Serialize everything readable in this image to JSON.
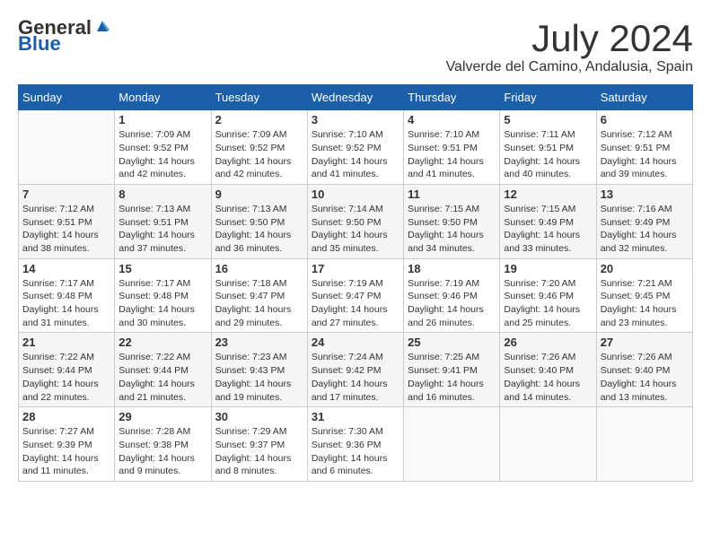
{
  "header": {
    "logo_general": "General",
    "logo_blue": "Blue",
    "month_year": "July 2024",
    "location": "Valverde del Camino, Andalusia, Spain"
  },
  "calendar": {
    "days_of_week": [
      "Sunday",
      "Monday",
      "Tuesday",
      "Wednesday",
      "Thursday",
      "Friday",
      "Saturday"
    ],
    "weeks": [
      [
        {
          "day": "",
          "info": ""
        },
        {
          "day": "1",
          "info": "Sunrise: 7:09 AM\nSunset: 9:52 PM\nDaylight: 14 hours\nand 42 minutes."
        },
        {
          "day": "2",
          "info": "Sunrise: 7:09 AM\nSunset: 9:52 PM\nDaylight: 14 hours\nand 42 minutes."
        },
        {
          "day": "3",
          "info": "Sunrise: 7:10 AM\nSunset: 9:52 PM\nDaylight: 14 hours\nand 41 minutes."
        },
        {
          "day": "4",
          "info": "Sunrise: 7:10 AM\nSunset: 9:51 PM\nDaylight: 14 hours\nand 41 minutes."
        },
        {
          "day": "5",
          "info": "Sunrise: 7:11 AM\nSunset: 9:51 PM\nDaylight: 14 hours\nand 40 minutes."
        },
        {
          "day": "6",
          "info": "Sunrise: 7:12 AM\nSunset: 9:51 PM\nDaylight: 14 hours\nand 39 minutes."
        }
      ],
      [
        {
          "day": "7",
          "info": "Sunrise: 7:12 AM\nSunset: 9:51 PM\nDaylight: 14 hours\nand 38 minutes."
        },
        {
          "day": "8",
          "info": "Sunrise: 7:13 AM\nSunset: 9:51 PM\nDaylight: 14 hours\nand 37 minutes."
        },
        {
          "day": "9",
          "info": "Sunrise: 7:13 AM\nSunset: 9:50 PM\nDaylight: 14 hours\nand 36 minutes."
        },
        {
          "day": "10",
          "info": "Sunrise: 7:14 AM\nSunset: 9:50 PM\nDaylight: 14 hours\nand 35 minutes."
        },
        {
          "day": "11",
          "info": "Sunrise: 7:15 AM\nSunset: 9:50 PM\nDaylight: 14 hours\nand 34 minutes."
        },
        {
          "day": "12",
          "info": "Sunrise: 7:15 AM\nSunset: 9:49 PM\nDaylight: 14 hours\nand 33 minutes."
        },
        {
          "day": "13",
          "info": "Sunrise: 7:16 AM\nSunset: 9:49 PM\nDaylight: 14 hours\nand 32 minutes."
        }
      ],
      [
        {
          "day": "14",
          "info": "Sunrise: 7:17 AM\nSunset: 9:48 PM\nDaylight: 14 hours\nand 31 minutes."
        },
        {
          "day": "15",
          "info": "Sunrise: 7:17 AM\nSunset: 9:48 PM\nDaylight: 14 hours\nand 30 minutes."
        },
        {
          "day": "16",
          "info": "Sunrise: 7:18 AM\nSunset: 9:47 PM\nDaylight: 14 hours\nand 29 minutes."
        },
        {
          "day": "17",
          "info": "Sunrise: 7:19 AM\nSunset: 9:47 PM\nDaylight: 14 hours\nand 27 minutes."
        },
        {
          "day": "18",
          "info": "Sunrise: 7:19 AM\nSunset: 9:46 PM\nDaylight: 14 hours\nand 26 minutes."
        },
        {
          "day": "19",
          "info": "Sunrise: 7:20 AM\nSunset: 9:46 PM\nDaylight: 14 hours\nand 25 minutes."
        },
        {
          "day": "20",
          "info": "Sunrise: 7:21 AM\nSunset: 9:45 PM\nDaylight: 14 hours\nand 23 minutes."
        }
      ],
      [
        {
          "day": "21",
          "info": "Sunrise: 7:22 AM\nSunset: 9:44 PM\nDaylight: 14 hours\nand 22 minutes."
        },
        {
          "day": "22",
          "info": "Sunrise: 7:22 AM\nSunset: 9:44 PM\nDaylight: 14 hours\nand 21 minutes."
        },
        {
          "day": "23",
          "info": "Sunrise: 7:23 AM\nSunset: 9:43 PM\nDaylight: 14 hours\nand 19 minutes."
        },
        {
          "day": "24",
          "info": "Sunrise: 7:24 AM\nSunset: 9:42 PM\nDaylight: 14 hours\nand 17 minutes."
        },
        {
          "day": "25",
          "info": "Sunrise: 7:25 AM\nSunset: 9:41 PM\nDaylight: 14 hours\nand 16 minutes."
        },
        {
          "day": "26",
          "info": "Sunrise: 7:26 AM\nSunset: 9:40 PM\nDaylight: 14 hours\nand 14 minutes."
        },
        {
          "day": "27",
          "info": "Sunrise: 7:26 AM\nSunset: 9:40 PM\nDaylight: 14 hours\nand 13 minutes."
        }
      ],
      [
        {
          "day": "28",
          "info": "Sunrise: 7:27 AM\nSunset: 9:39 PM\nDaylight: 14 hours\nand 11 minutes."
        },
        {
          "day": "29",
          "info": "Sunrise: 7:28 AM\nSunset: 9:38 PM\nDaylight: 14 hours\nand 9 minutes."
        },
        {
          "day": "30",
          "info": "Sunrise: 7:29 AM\nSunset: 9:37 PM\nDaylight: 14 hours\nand 8 minutes."
        },
        {
          "day": "31",
          "info": "Sunrise: 7:30 AM\nSunset: 9:36 PM\nDaylight: 14 hours\nand 6 minutes."
        },
        {
          "day": "",
          "info": ""
        },
        {
          "day": "",
          "info": ""
        },
        {
          "day": "",
          "info": ""
        }
      ]
    ]
  }
}
